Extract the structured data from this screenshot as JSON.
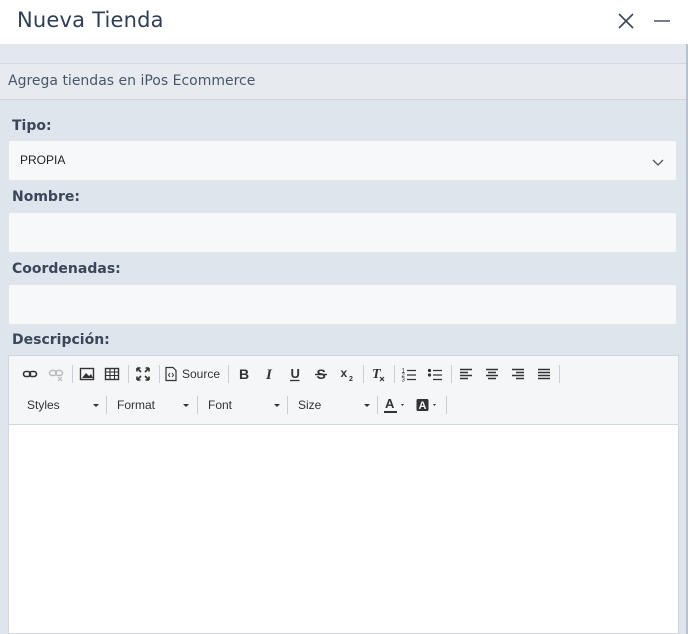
{
  "dialog": {
    "title": "Nueva Tienda",
    "subtitle": "Agrega tiendas en iPos Ecommerce"
  },
  "form": {
    "tipo_label": "Tipo:",
    "tipo_value": "PROPIA",
    "nombre_label": "Nombre:",
    "nombre_value": "",
    "coordenadas_label": "Coordenadas:",
    "coordenadas_value": "",
    "descripcion_label": "Descripción:"
  },
  "editor_toolbar": {
    "source_label": "Source",
    "styles_label": "Styles",
    "format_label": "Format",
    "font_label": "Font",
    "size_label": "Size",
    "icons": [
      "link-icon",
      "unlink-icon",
      "image-icon",
      "table-icon",
      "maximize-icon",
      "source-icon",
      "bold-icon",
      "italic-icon",
      "underline-icon",
      "strikethrough-icon",
      "subscript-icon",
      "remove-format-icon",
      "numbered-list-icon",
      "bulleted-list-icon",
      "align-left-icon",
      "align-center-icon",
      "align-right-icon",
      "justify-icon",
      "text-color-icon",
      "background-color-icon"
    ]
  },
  "colors": {
    "title": "#2f3e55",
    "page_bg": "#dfe5ec",
    "field_bg": "#f7f8fa"
  }
}
